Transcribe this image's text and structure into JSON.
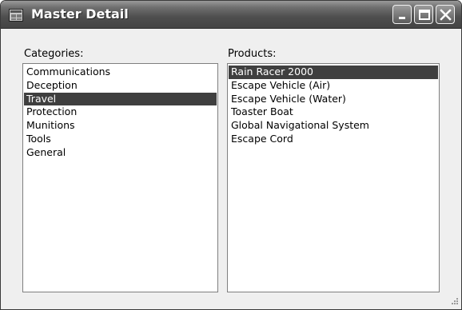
{
  "window": {
    "title": "Master Detail"
  },
  "categories": {
    "label": "Categories:",
    "items": [
      "Communications",
      "Deception",
      "Travel",
      "Protection",
      "Munitions",
      "Tools",
      "General"
    ],
    "selected": "Travel"
  },
  "products": {
    "label": "Products:",
    "items": [
      "Rain Racer 2000",
      "Escape Vehicle (Air)",
      "Escape Vehicle (Water)",
      "Toaster Boat",
      "Global Navigational System",
      "Escape Cord"
    ],
    "selected": "Rain Racer 2000"
  },
  "icons": {
    "app": "window-app-icon",
    "minimize": "minimize-icon",
    "maximize": "maximize-icon",
    "close": "close-icon",
    "grip": "size-grip-icon"
  },
  "colors": {
    "selection_bg": "#3f3f3f",
    "selection_fg": "#ffffff",
    "titlebar": "#4e4e4e"
  }
}
